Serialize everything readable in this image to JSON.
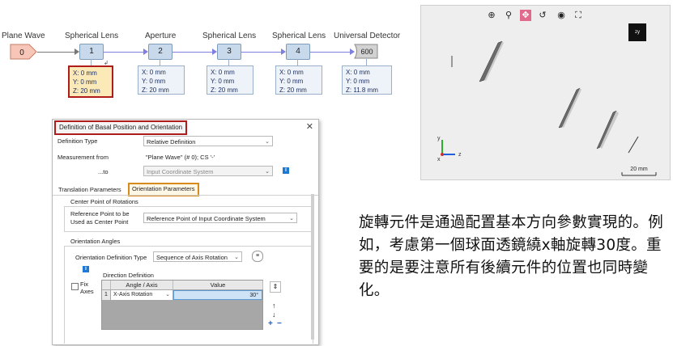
{
  "pipeline": {
    "nodes": [
      {
        "title": "Plane Wave",
        "box": "0",
        "kind": "source"
      },
      {
        "title": "Spherical Lens",
        "box": "1",
        "coords": [
          "X: 0 mm",
          "Y: 0 mm",
          "Z: 20 mm"
        ],
        "highlighted": true
      },
      {
        "title": "Aperture",
        "box": "2",
        "coords": [
          "X: 0 mm",
          "Y: 0 mm",
          "Z: 20 mm"
        ]
      },
      {
        "title": "Spherical Lens",
        "box": "3",
        "coords": [
          "X: 0 mm",
          "Y: 0 mm",
          "Z: 20 mm"
        ]
      },
      {
        "title": "Spherical Lens",
        "box": "4",
        "coords": [
          "X: 0 mm",
          "Y: 0 mm",
          "Z: 20 mm"
        ]
      },
      {
        "title": "Universal Detector",
        "box": "600",
        "kind": "detector",
        "coords": [
          "X: 0 mm",
          "Y: 0 mm",
          "Z: 11.8 mm"
        ]
      }
    ]
  },
  "dialog": {
    "title": "Definition of Basal Position and Orientation",
    "close": "✕",
    "definition_type_label": "Definition Type",
    "definition_type_value": "Relative Definition",
    "measurement_from_label": "Measurement from",
    "measurement_from_value": "\"Plane Wave\" (# 0); CS '-'",
    "to_label": "...to",
    "to_value": "Input Coordinate System",
    "tabs": [
      "Translation Parameters",
      "Orientation Parameters"
    ],
    "center_group": "Center Point of Rotations",
    "ref_point_label_1": "Reference Point to be",
    "ref_point_label_2": "Used as Center Point",
    "ref_point_value": "Reference Point of Input Coordinate System",
    "angles_group": "Orientation Angles",
    "orient_def_label": "Orientation Definition Type",
    "orient_def_value": "Sequence of Axis Rotation",
    "fix_axes_label_1": "Fix",
    "fix_axes_label_2": "Axes",
    "direction_def": "Direction Definition",
    "table": {
      "headers": [
        "Angle / Axis",
        "Value"
      ],
      "rows": [
        {
          "index": "1",
          "axis": "X-Axis Rotation",
          "value": "30°"
        }
      ]
    },
    "buttons": {
      "up": "↑",
      "down": "↓",
      "add": "+",
      "remove": "−",
      "sort": "⇕"
    }
  },
  "view3d": {
    "tools": [
      "zoom-fit-icon",
      "zoom-icon",
      "pan-icon",
      "rotate-icon",
      "view-icon",
      "fullscreen-icon"
    ],
    "orientation_cube_label": "zy",
    "axis_labels": {
      "y": "y",
      "z": "z",
      "x": "x"
    },
    "scale_bar": "20 mm"
  },
  "paragraph": "旋轉元件是通過配置基本方向參數實現的。例如，考慮第一個球面透鏡繞x軸旋轉30度。重要的是要注意所有後續元件的位置也同時變化。",
  "colors": {
    "highlight_border": "#b01c1c",
    "tab_highlight": "#d88a1a",
    "node_fill": "#c9d9ec",
    "coord_fill": "#eef3f9",
    "coord_highlight": "#fbe9b8"
  }
}
